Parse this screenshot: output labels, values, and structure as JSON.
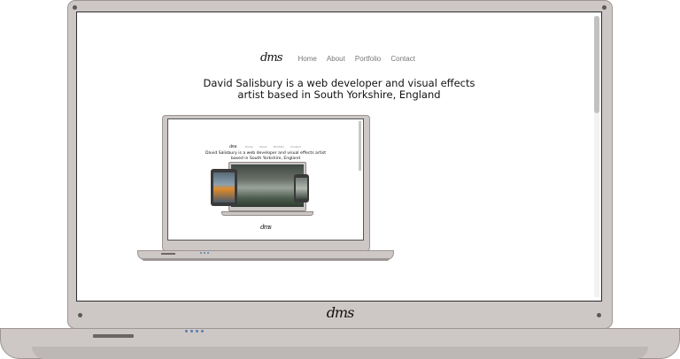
{
  "brand": {
    "logo": "dms"
  },
  "nav": {
    "items": [
      "Home",
      "About",
      "Portfolio",
      "Contact"
    ]
  },
  "hero": {
    "headline_line1": "David Salisbury is a web developer and visual effects",
    "headline_line2": "artist based in South Yorkshire, England"
  },
  "mockup": {
    "logo": "dms",
    "nav_items": [
      "Home",
      "About",
      "Portfolio",
      "Contact"
    ],
    "headline_line1": "David Salisbury is a web developer and visual effects artist",
    "headline_line2": "based in South Yorkshire, England",
    "bezel_logo": "dms"
  },
  "device": {
    "bezel_logo": "dms"
  },
  "colors": {
    "bezel": "#cdc7c6",
    "bezel_border": "#9c9593",
    "screen": "#ffffff",
    "text": "#111111",
    "nav_text": "#777777",
    "led": "#5a7ea8"
  }
}
